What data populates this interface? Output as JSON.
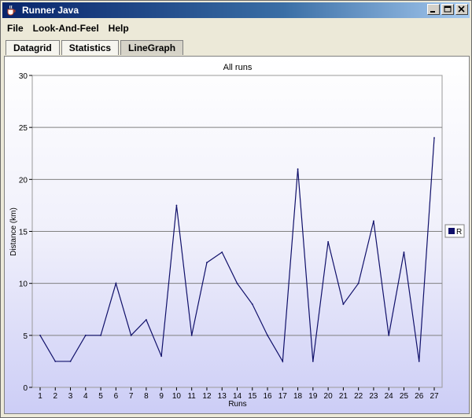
{
  "window": {
    "title": "Runner Java",
    "icon": "java-cup-icon"
  },
  "menu": [
    "File",
    "Look-And-Feel",
    "Help"
  ],
  "tabs": [
    {
      "label": "Datagrid",
      "selected": false
    },
    {
      "label": "Statistics",
      "selected": false
    },
    {
      "label": "LineGraph",
      "selected": true
    }
  ],
  "colors": {
    "line": "#10106a",
    "title_bar_start": "#08246b",
    "plot_bg_bottom": "#cccdf6"
  },
  "chart_data": {
    "type": "line",
    "title": "All runs",
    "xlabel": "Runs",
    "ylabel": "Distance (km)",
    "ylim": [
      0,
      30
    ],
    "yticks": [
      0,
      5,
      10,
      15,
      20,
      25,
      30
    ],
    "grid": true,
    "legend_position": "right",
    "x": [
      1,
      2,
      3,
      4,
      5,
      6,
      7,
      8,
      9,
      10,
      11,
      12,
      13,
      14,
      15,
      16,
      17,
      18,
      19,
      20,
      21,
      22,
      23,
      24,
      25,
      26,
      27
    ],
    "series": [
      {
        "name": "R",
        "values": [
          5,
          2.5,
          2.5,
          5,
          5,
          10,
          5,
          6.5,
          3,
          17.5,
          5,
          12,
          13,
          10,
          8,
          5,
          2.5,
          21,
          2.5,
          14,
          8,
          10,
          16,
          5,
          13,
          2.5,
          24
        ]
      }
    ]
  }
}
